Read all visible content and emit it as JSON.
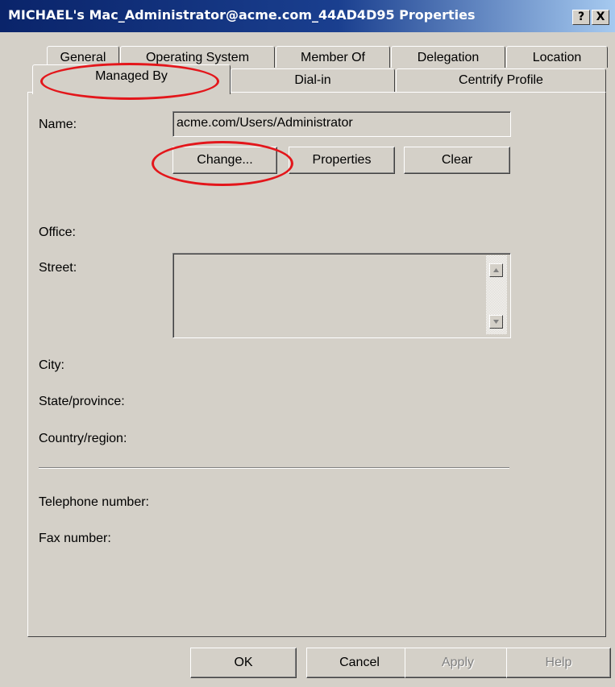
{
  "window": {
    "title": "MICHAEL's Mac_Administrator@acme.com_44AD4D95 Properties",
    "help_btn": "?",
    "close_btn": "X"
  },
  "tabs": {
    "row_back": [
      "General",
      "Operating System",
      "Member Of",
      "Delegation",
      "Location"
    ],
    "row_front": [
      "Managed By",
      "Dial-in",
      "Centrify Profile"
    ],
    "active": "Managed By"
  },
  "managed_by": {
    "name_label": "Name:",
    "name_value": "acme.com/Users/Administrator",
    "change_btn": "Change...",
    "properties_btn": "Properties",
    "clear_btn": "Clear",
    "office_label": "Office:",
    "street_label": "Street:",
    "street_value": "",
    "city_label": "City:",
    "state_label": "State/province:",
    "country_label": "Country/region:",
    "telephone_label": "Telephone number:",
    "fax_label": "Fax number:"
  },
  "footer": {
    "ok": "OK",
    "cancel": "Cancel",
    "apply": "Apply",
    "help": "Help"
  },
  "annotation_color": "#e3161b"
}
